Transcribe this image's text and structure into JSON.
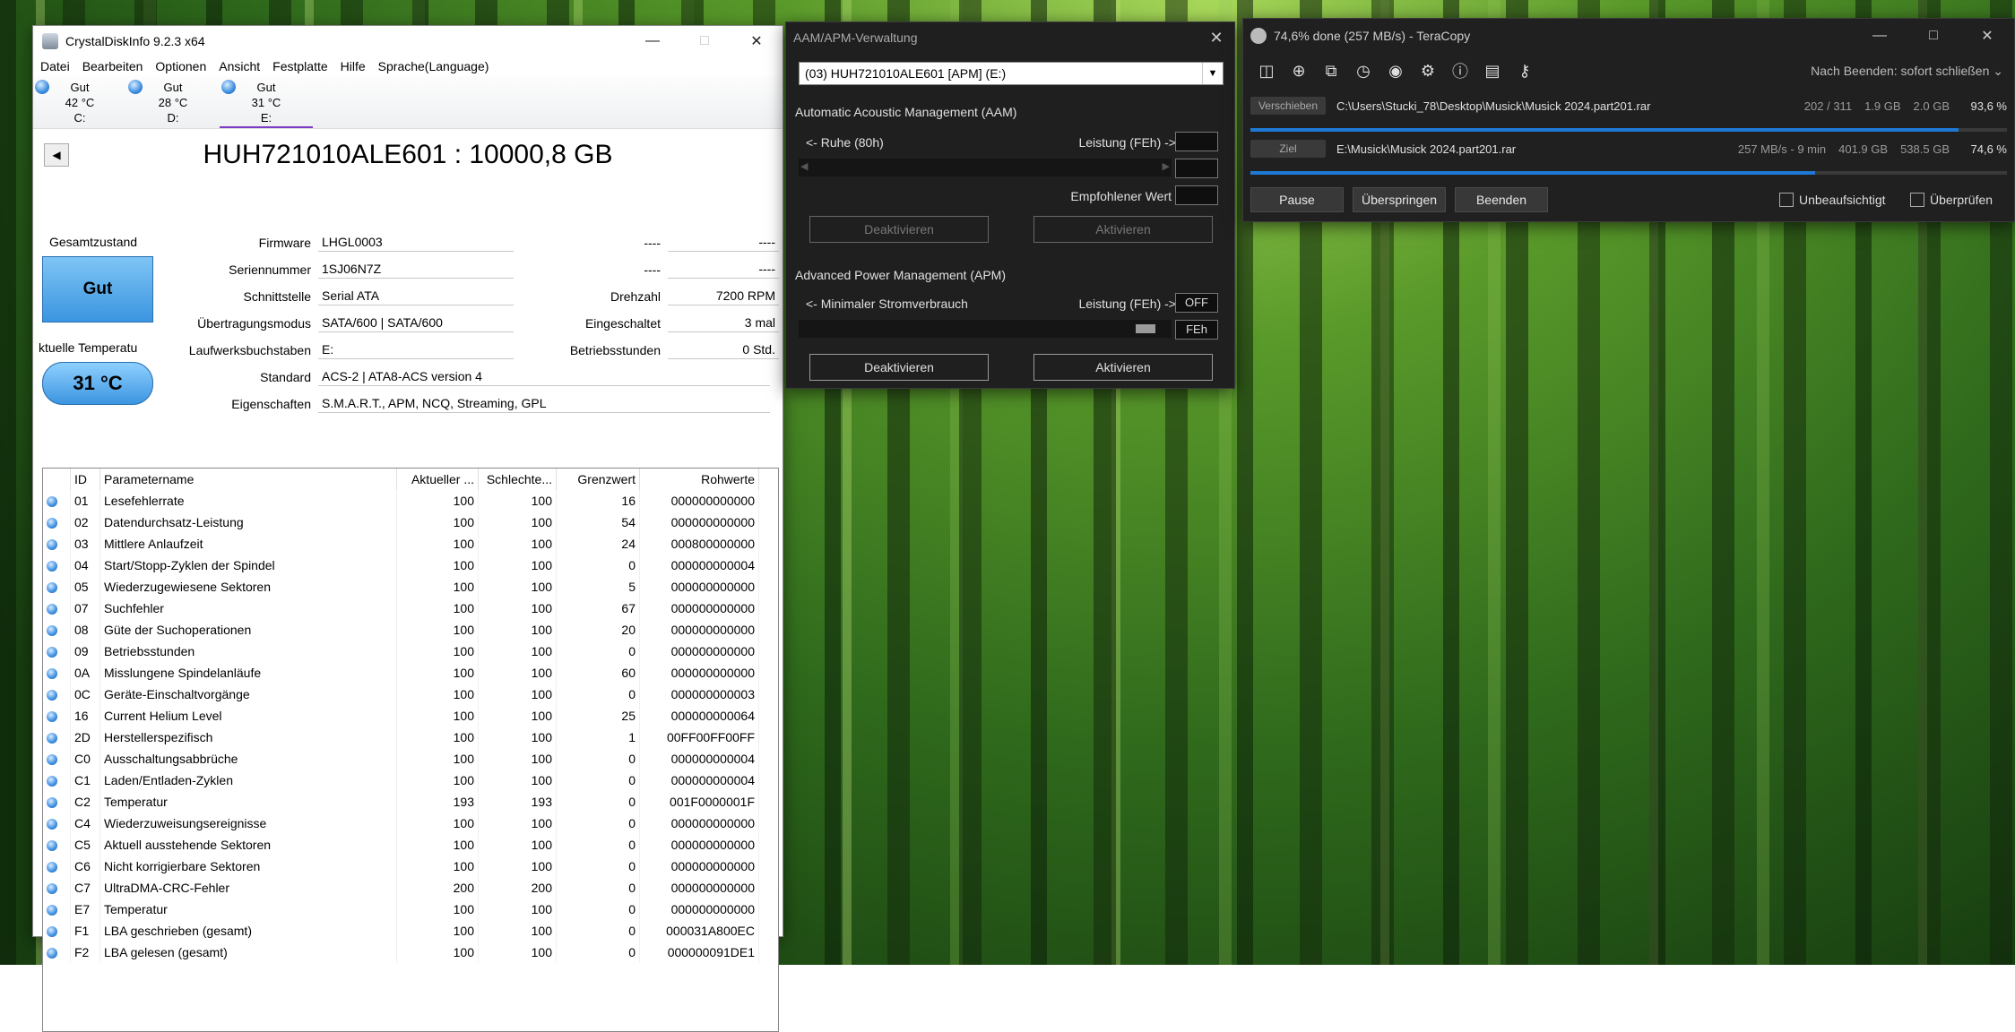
{
  "cdi": {
    "title": "CrystalDiskInfo 9.2.3 x64",
    "menu": [
      "Datei",
      "Bearbeiten",
      "Optionen",
      "Ansicht",
      "Festplatte",
      "Hilfe",
      "Sprache(Language)"
    ],
    "drives": [
      {
        "status": "Gut",
        "temp": "42 °C",
        "letter": "C:"
      },
      {
        "status": "Gut",
        "temp": "28 °C",
        "letter": "D:"
      },
      {
        "status": "Gut",
        "temp": "31 °C",
        "letter": "E:"
      }
    ],
    "model": "HUH721010ALE601 : 10000,8 GB",
    "health_label": "Gesamtzustand",
    "health_value": "Gut",
    "temp_label": "ktuelle Temperatu",
    "temp_value": "31 °C",
    "firmware_label": "Firmware",
    "firmware": "LHGL0003",
    "serial_label": "Seriennummer",
    "serial": "1SJ06N7Z",
    "interface_label": "Schnittstelle",
    "interface": "Serial ATA",
    "transfer_label": "Übertragungsmodus",
    "transfer": "SATA/600 | SATA/600",
    "letter_label": "Laufwerksbuchstaben",
    "letter": "E:",
    "standard_label": "Standard",
    "standard": "ACS-2 | ATA8-ACS version 4",
    "features_label": "Eigenschaften",
    "features": "S.M.A.R.T., APM, NCQ, Streaming, GPL",
    "r1_label": "----",
    "r1_value": "----",
    "r2_label": "----",
    "r2_value": "----",
    "rpm_label": "Drehzahl",
    "rpm": "7200 RPM",
    "poweron_count_label": "Eingeschaltet",
    "poweron_count": "3 mal",
    "hours_label": "Betriebsstunden",
    "hours": "0 Std.",
    "smart_headers": [
      "ID",
      "Parametername",
      "Aktueller ...",
      "Schlechte...",
      "Grenzwert",
      "Rohwerte"
    ],
    "smart_rows": [
      [
        "01",
        "Lesefehlerrate",
        "100",
        "100",
        "16",
        "000000000000"
      ],
      [
        "02",
        "Datendurchsatz-Leistung",
        "100",
        "100",
        "54",
        "000000000000"
      ],
      [
        "03",
        "Mittlere Anlaufzeit",
        "100",
        "100",
        "24",
        "000800000000"
      ],
      [
        "04",
        "Start/Stopp-Zyklen der Spindel",
        "100",
        "100",
        "0",
        "000000000004"
      ],
      [
        "05",
        "Wiederzugewiesene Sektoren",
        "100",
        "100",
        "5",
        "000000000000"
      ],
      [
        "07",
        "Suchfehler",
        "100",
        "100",
        "67",
        "000000000000"
      ],
      [
        "08",
        "Güte der Suchoperationen",
        "100",
        "100",
        "20",
        "000000000000"
      ],
      [
        "09",
        "Betriebsstunden",
        "100",
        "100",
        "0",
        "000000000000"
      ],
      [
        "0A",
        "Misslungene Spindelanläufe",
        "100",
        "100",
        "60",
        "000000000000"
      ],
      [
        "0C",
        "Geräte-Einschaltvorgänge",
        "100",
        "100",
        "0",
        "000000000003"
      ],
      [
        "16",
        "Current Helium Level",
        "100",
        "100",
        "25",
        "000000000064"
      ],
      [
        "2D",
        "Herstellerspezifisch",
        "100",
        "100",
        "1",
        "00FF00FF00FF"
      ],
      [
        "C0",
        "Ausschaltungsabbrüche",
        "100",
        "100",
        "0",
        "000000000004"
      ],
      [
        "C1",
        "Laden/Entladen-Zyklen",
        "100",
        "100",
        "0",
        "000000000004"
      ],
      [
        "C2",
        "Temperatur",
        "193",
        "193",
        "0",
        "001F0000001F"
      ],
      [
        "C4",
        "Wiederzuweisungsereignisse",
        "100",
        "100",
        "0",
        "000000000000"
      ],
      [
        "C5",
        "Aktuell ausstehende Sektoren",
        "100",
        "100",
        "0",
        "000000000000"
      ],
      [
        "C6",
        "Nicht korrigierbare Sektoren",
        "100",
        "100",
        "0",
        "000000000000"
      ],
      [
        "C7",
        "UltraDMA-CRC-Fehler",
        "200",
        "200",
        "0",
        "000000000000"
      ],
      [
        "E7",
        "Temperatur",
        "100",
        "100",
        "0",
        "000000000000"
      ],
      [
        "F1",
        "LBA geschrieben (gesamt)",
        "100",
        "100",
        "0",
        "000031A800EC"
      ],
      [
        "F2",
        "LBA gelesen (gesamt)",
        "100",
        "100",
        "0",
        "000000091DE1"
      ]
    ]
  },
  "aam": {
    "title": "AAM/APM-Verwaltung",
    "select_value": "(03) HUH721010ALE601 [APM] (E:)",
    "aam_heading": "Automatic Acoustic Management (AAM)",
    "aam_left": "<- Ruhe (80h)",
    "aam_right": "Leistung (FEh) ->",
    "recommended": "Empfohlener Wert",
    "aam_disable": "Deaktivieren",
    "aam_enable": "Aktivieren",
    "apm_heading": "Advanced Power Management (APM)",
    "apm_left": "<- Minimaler Stromverbrauch",
    "apm_right": "Leistung (FEh) ->",
    "apm_value1": "OFF",
    "apm_value2": "FEh",
    "apm_disable": "Deaktivieren",
    "apm_enable": "Aktivieren"
  },
  "tc": {
    "title": "74,6% done (257 MB/s) - TeraCopy",
    "after_label": "Nach Beenden: sofort schließen",
    "src_tag": "Verschieben",
    "src_path": "C:\\Users\\Stucki_78\\Desktop\\Musick\\Musick 2024.part201.rar",
    "src_count": "202 / 311",
    "src_done": "1.9 GB",
    "src_total": "2.0 GB",
    "src_pct": "93,6 %",
    "src_progress": 0.936,
    "dst_tag": "Ziel",
    "dst_path": "E:\\Musick\\Musick 2024.part201.rar",
    "dst_info": "257 MB/s - 9 min",
    "dst_done": "401.9 GB",
    "dst_total": "538.5 GB",
    "dst_pct": "74,6 %",
    "dst_progress": 0.746,
    "btn_pause": "Pause",
    "btn_skip": "Überspringen",
    "btn_stop": "Beenden",
    "chk_unattended": "Unbeaufsichtigt",
    "chk_verify": "Überprüfen"
  }
}
